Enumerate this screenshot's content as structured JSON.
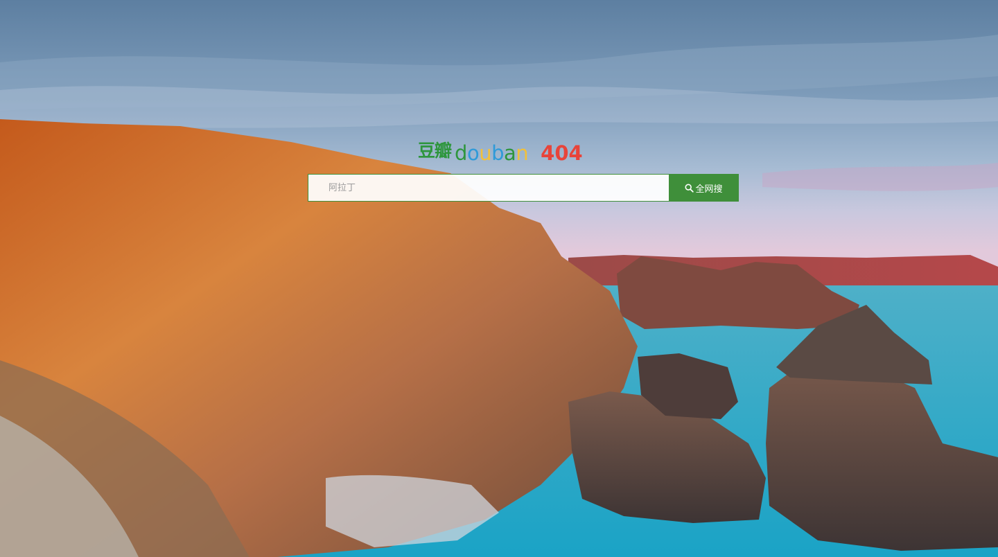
{
  "brand": {
    "name_cn": "豆瓣",
    "letters": [
      {
        "ch": "d",
        "color": "#2e963d"
      },
      {
        "ch": "o",
        "color": "#2f9ad9"
      },
      {
        "ch": "u",
        "color": "#f2c13a"
      },
      {
        "ch": "b",
        "color": "#2f9ad9"
      },
      {
        "ch": "a",
        "color": "#2e963d"
      },
      {
        "ch": "n",
        "color": "#f2c13a"
      }
    ],
    "error_code": "404"
  },
  "search": {
    "placeholder": "阿拉丁",
    "button_label": "全网搜",
    "button_icon": "search-icon"
  },
  "colors": {
    "accent": "#3f8f3a",
    "error": "#e8443a"
  }
}
